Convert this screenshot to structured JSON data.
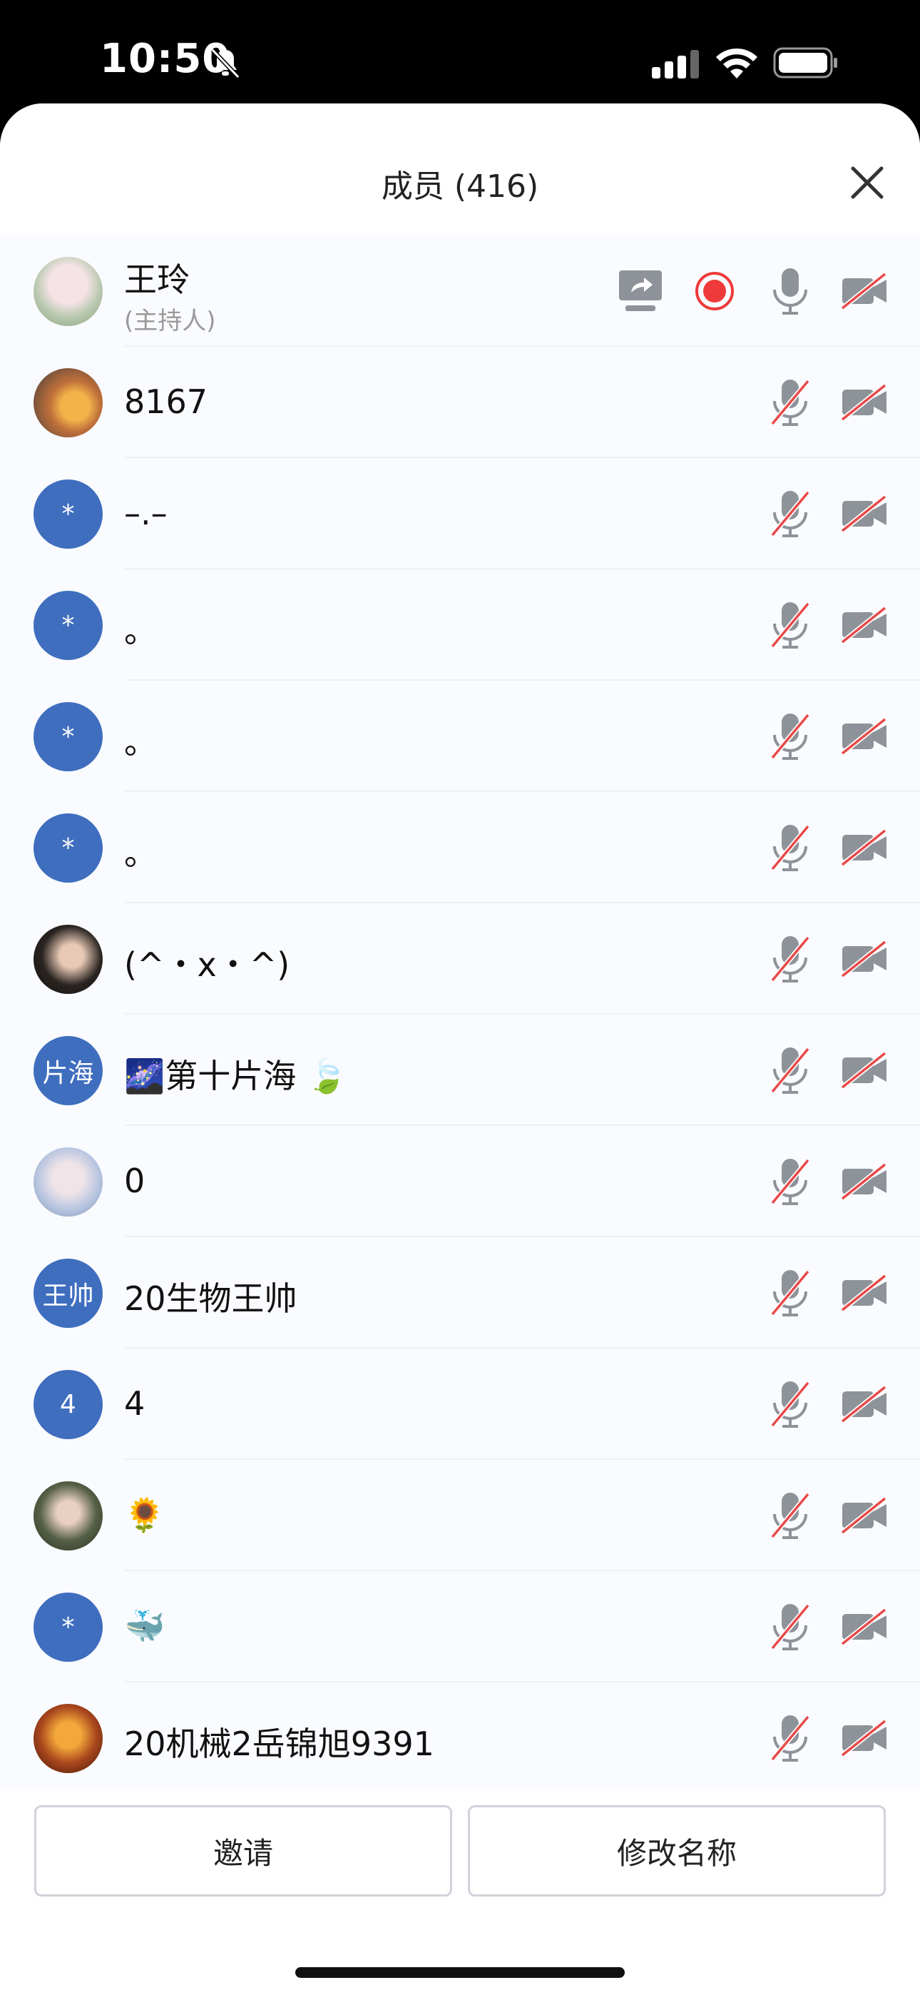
{
  "status_bar": {
    "time": "10:50"
  },
  "sheet": {
    "title": "成员 (416)"
  },
  "members": [
    {
      "avatar_text": "",
      "avatar_kind": "photo",
      "name": "王玲",
      "role": "(主持人)",
      "host": true,
      "mic_muted": false,
      "camera_off": true
    },
    {
      "avatar_text": "",
      "avatar_kind": "photo",
      "name": "  8167",
      "host": false,
      "mic_muted": true,
      "camera_off": true
    },
    {
      "avatar_text": "*",
      "avatar_kind": "initial",
      "name": "–.–",
      "host": false,
      "mic_muted": true,
      "camera_off": true
    },
    {
      "avatar_text": "*",
      "avatar_kind": "initial",
      "name": "。",
      "host": false,
      "mic_muted": true,
      "camera_off": true
    },
    {
      "avatar_text": "*",
      "avatar_kind": "initial",
      "name": "。",
      "host": false,
      "mic_muted": true,
      "camera_off": true
    },
    {
      "avatar_text": "*",
      "avatar_kind": "initial",
      "name": "。",
      "host": false,
      "mic_muted": true,
      "camera_off": true
    },
    {
      "avatar_text": "",
      "avatar_kind": "photo",
      "name": "(^・x・^)",
      "host": false,
      "mic_muted": true,
      "camera_off": true
    },
    {
      "avatar_text": "片海",
      "avatar_kind": "initial",
      "name": "🌌第十片海 🍃",
      "host": false,
      "mic_muted": true,
      "camera_off": true
    },
    {
      "avatar_text": "",
      "avatar_kind": "photo",
      "name": "0",
      "host": false,
      "mic_muted": true,
      "camera_off": true
    },
    {
      "avatar_text": "王帅",
      "avatar_kind": "initial",
      "name": "20生物王帅",
      "host": false,
      "mic_muted": true,
      "camera_off": true
    },
    {
      "avatar_text": "4",
      "avatar_kind": "initial",
      "name": "4",
      "host": false,
      "mic_muted": true,
      "camera_off": true
    },
    {
      "avatar_text": "",
      "avatar_kind": "photo",
      "name": "🌻",
      "host": false,
      "mic_muted": true,
      "camera_off": true
    },
    {
      "avatar_text": "*",
      "avatar_kind": "initial",
      "name": "🐳",
      "host": false,
      "mic_muted": true,
      "camera_off": true
    },
    {
      "avatar_text": "",
      "avatar_kind": "photo",
      "name": "20机械2岳锦旭9391",
      "host": false,
      "mic_muted": true,
      "camera_off": true
    }
  ],
  "footer": {
    "invite_label": "邀请",
    "rename_label": "修改名称"
  },
  "colors": {
    "accent": "#3f6ebf",
    "record": "#ee3a3a",
    "mute_slash": "#e84a4a",
    "icon_gray": "#8e9299"
  },
  "icons": {
    "close": "close-icon",
    "share": "screen-share-icon",
    "record": "record-icon",
    "mic": "microphone-icon",
    "mic_muted": "microphone-muted-icon",
    "camera_off": "camera-off-icon"
  }
}
